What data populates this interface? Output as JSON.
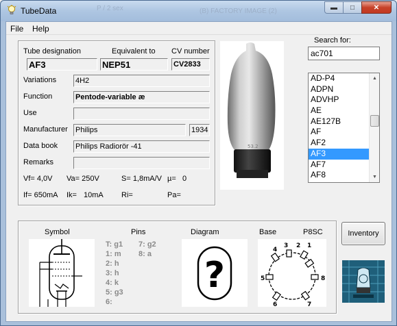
{
  "window": {
    "title": "TubeData",
    "bg_text_1": "P / 2 sex",
    "bg_text_2": "(B) FACTORY IMAGE (2)"
  },
  "menu": [
    "File",
    "Help"
  ],
  "details": {
    "tube_designation_label": "Tube designation",
    "equivalent_label": "Equivalent to",
    "cv_label": "CV number",
    "tube_designation": "AF3",
    "equivalent": "NEP51",
    "cv_number": "CV2833",
    "variations_label": "Variations",
    "variations": "4H2",
    "function_label": "Function",
    "function": "Pentode-variable æ",
    "use_label": "Use",
    "use": "",
    "manufacturer_label": "Manufacturer",
    "manufacturer": "Philips",
    "year": "1934",
    "databook_label": "Data book",
    "databook": "Philips Radiorör -41",
    "remarks_label": "Remarks",
    "remarks": "",
    "vf": "Vf= 4,0V",
    "va": "Va= 250V",
    "s": "S= 1,8mA/V",
    "mu": "µ=",
    "mu_val": "0",
    "if": "If= 650mA",
    "ik": "Ik=",
    "ik_val": "10mA",
    "ri": "Ri=",
    "pa": "Pa="
  },
  "search": {
    "label": "Search for:",
    "value": "ac701",
    "list": [
      "AD-P4",
      "ADPN",
      "ADVHP",
      "AE",
      "AE127B",
      "AF",
      "AF2",
      "AF3",
      "AF7",
      "AF8"
    ],
    "selected": "AF3"
  },
  "bottom": {
    "symbol_label": "Symbol",
    "pins_label": "Pins",
    "diagram_label": "Diagram",
    "base_label": "Base",
    "base_type": "P8SC",
    "pins_left": [
      "T: g1",
      "1: m",
      "2: h",
      "3: h",
      "4: k",
      "5: g3",
      "6:"
    ],
    "pins_right": [
      "7: g2",
      "8: a"
    ],
    "diagram_mark": "?",
    "base_pins": [
      "1",
      "2",
      "3",
      "4",
      "5",
      "6",
      "7",
      "8"
    ],
    "inventory_button": "Inventory"
  },
  "colors": {
    "selection": "#3399ff",
    "pins_text": "#8a8a8a"
  }
}
